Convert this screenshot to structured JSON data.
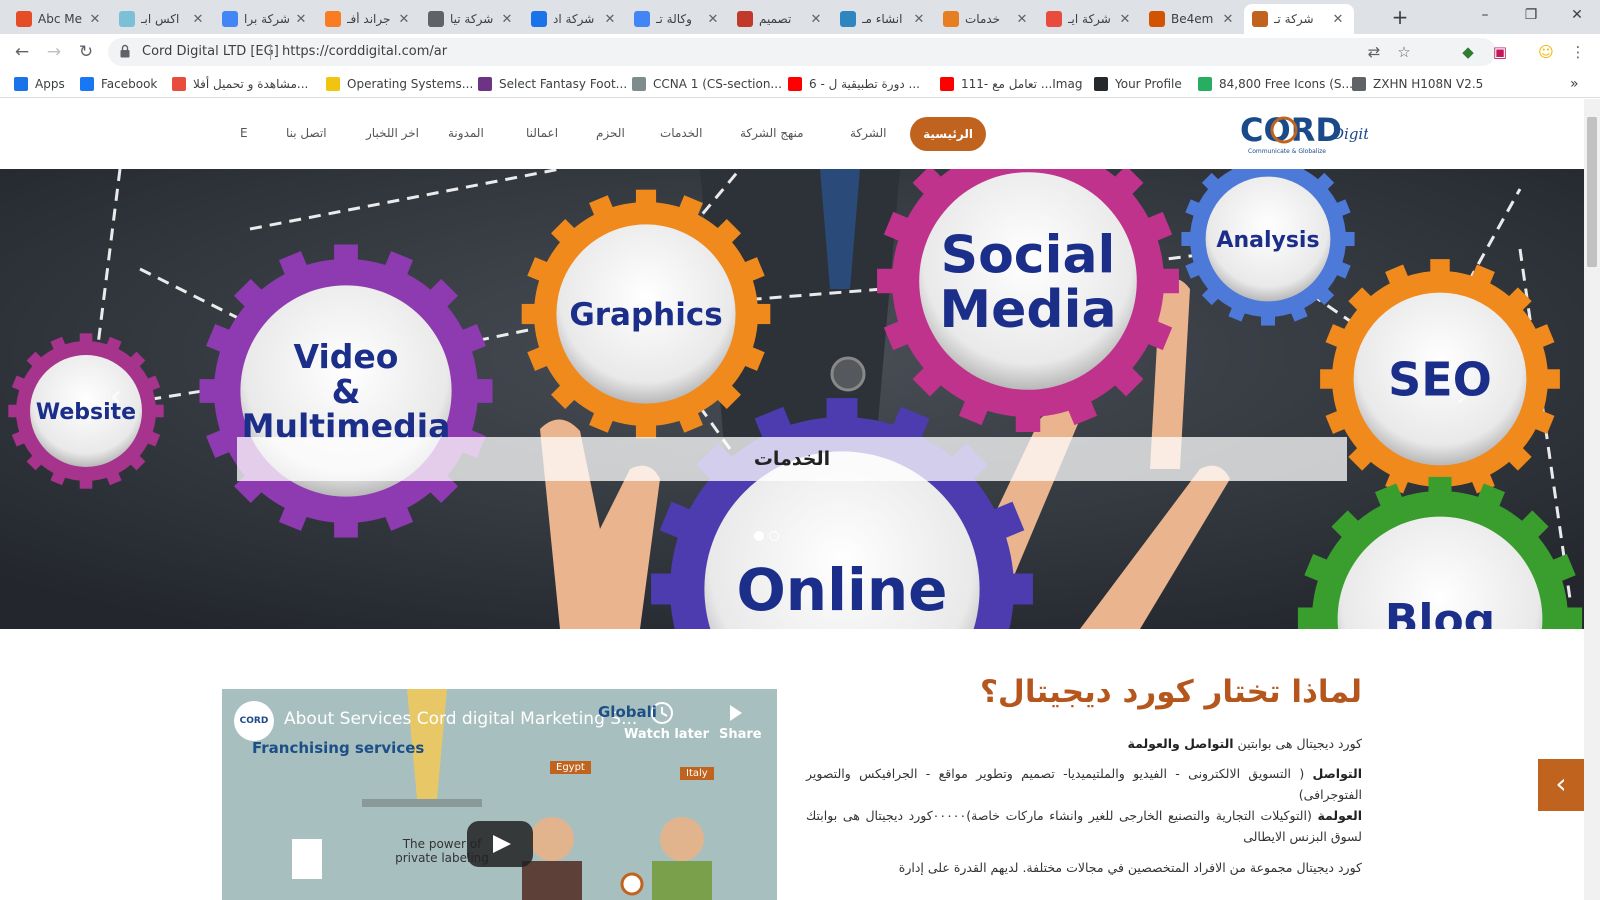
{
  "browser": {
    "tabs": [
      {
        "title": "Abc Me",
        "color": "#e44d26"
      },
      {
        "title": "اكس ابـ",
        "color": "#7cc0d8"
      },
      {
        "title": "شركة برا",
        "color": "#4285f4"
      },
      {
        "title": "جراند أفـ",
        "color": "#f97b22"
      },
      {
        "title": "شركة تيا",
        "color": "#5f6368"
      },
      {
        "title": "شركة اد",
        "color": "#1a73e8"
      },
      {
        "title": "وكالة تـ",
        "color": "#4285f4"
      },
      {
        "title": "تصميم",
        "color": "#c0392b"
      },
      {
        "title": "انشاء مـ",
        "color": "#2e86c1"
      },
      {
        "title": "خدمات",
        "color": "#e67e22"
      },
      {
        "title": "شركة ايـ",
        "color": "#e74c3c"
      },
      {
        "title": "Be4em",
        "color": "#d35400"
      },
      {
        "title": "شركة تـ",
        "color": "#c0631e",
        "active": true
      }
    ],
    "new_tab": "+",
    "window": {
      "minimize": "–",
      "restore": "❐",
      "close": "✕"
    },
    "nav": {
      "back": "←",
      "forward": "→",
      "reload": "↻"
    },
    "address": {
      "site_name": "Cord Digital LTD [EG]",
      "url": "https://corddigital.com/ar"
    },
    "toolbar_icons": {
      "translate": "⇄",
      "star": "☆",
      "ext1": "◆",
      "ext2": "▣",
      "profile": "☺",
      "menu": "⋮"
    },
    "bookmarks": [
      {
        "label": "Apps",
        "color": "#1a73e8"
      },
      {
        "label": "Facebook",
        "color": "#1877f2"
      },
      {
        "label": "مشاهدة و تحميل أفلا...",
        "color": "#e74c3c"
      },
      {
        "label": "Operating Systems...",
        "color": "#f1c40f"
      },
      {
        "label": "Select Fantasy Foot...",
        "color": "#6c3483"
      },
      {
        "label": "CCNA 1 (CS-section...",
        "color": "#7f8c8d"
      },
      {
        "label": "6 - دورة تطبيقية ل ...",
        "color": "#ff0000"
      },
      {
        "label": "111- تعامل مع ...Imag",
        "color": "#ff0000"
      },
      {
        "label": "Your Profile",
        "color": "#24292e"
      },
      {
        "label": "84,800 Free Icons (S...",
        "color": "#27ae60"
      },
      {
        "label": "ZXHN H108N V2.5",
        "color": "#5f6368"
      }
    ],
    "bookmarks_more": "»"
  },
  "site": {
    "brand_colors": {
      "accent": "#c0631e",
      "title": "#b5561d"
    },
    "logo": {
      "text": "CORD",
      "script": "Digital",
      "tagline": "Communicate & Globalize"
    },
    "nav": {
      "home": "الرئيسية",
      "items": [
        "الشركة",
        "منهج الشركة",
        "الخدمات",
        "الحزم",
        "اعمالنا",
        "المدونة",
        "اخر اللخبار",
        "اتصل بنا",
        "E"
      ]
    },
    "hero": {
      "caption": "الخدمات",
      "prev": "‹",
      "next": "›",
      "gears": [
        "Website",
        "Video & Multimedia",
        "Graphics",
        "Social Media",
        "Analysis",
        "SEO",
        "Online",
        "Blog"
      ]
    },
    "video": {
      "title": "About Services Cord digital Marketing S...",
      "channel_logo": "CORD",
      "watch_later": "Watch later",
      "share": "Share",
      "franchising": "Franchising services",
      "globalization": "Globali",
      "egypt": "Egypt",
      "italy": "Italy",
      "private_label": "The power of private labeling"
    },
    "why": {
      "title": "لماذا تختار كورد ديجيتال؟",
      "intro_text": "كورد ديجيتال هى بوابتين ",
      "intro_bold": "التواصل والعولمة",
      "p1_bold": "التواصل",
      "p1_text": " ( التسويق الالكترونى - الفيديو والملتيميديا- تصميم وتطوير مواقع - الجرافيكس والتصوير الفتوجرافى)",
      "p2_bold": "العولمة",
      "p2_text": " (التوكيلات التجارية والتصنيع الخارجى للغير وانشاء ماركات خاصة)٠٠٠٠٠كورد ديجيتال هى بوابتك لسوق البزنس الايطالى",
      "p3_text": "كورد ديجيتال مجموعة من الافراد المتخصصين في مجالات مختلفة. لديهم القدرة على إدارة"
    },
    "side_button": "‹"
  }
}
